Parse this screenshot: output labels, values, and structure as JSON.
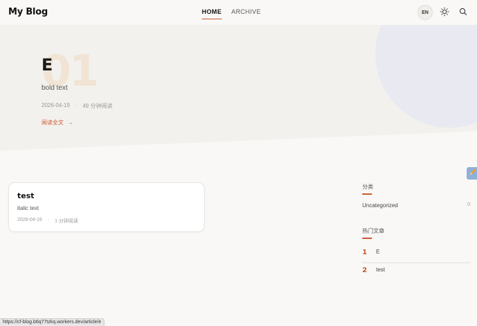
{
  "header": {
    "logo": "My Blog",
    "nav": [
      {
        "label": "HOME",
        "active": true
      },
      {
        "label": "ARCHIVE",
        "active": false
      }
    ],
    "lang": "EN",
    "icons": {
      "theme": "sun-icon",
      "search": "search-icon"
    }
  },
  "hero": {
    "number": "01",
    "title": "E",
    "subtitle": "bold text",
    "date": "2026-04-19",
    "separator": "·",
    "read_time": "49 分钟阅读",
    "read_more": "阅读全文",
    "arrow": "→"
  },
  "articles": [
    {
      "title": "test",
      "excerpt": "italic text",
      "date": "2026-04-19",
      "separator": "·",
      "read_time": "1 分钟阅读"
    }
  ],
  "sidebar": {
    "categories_heading": "分类",
    "categories": [
      {
        "name": "Uncategorized",
        "count": "0"
      }
    ],
    "popular_heading": "热门文章",
    "popular": [
      {
        "rank": "1",
        "title": "E"
      },
      {
        "rank": "2",
        "title": "test"
      }
    ]
  },
  "status_bar": {
    "url": "https://cf-blog.b6q77tzkq.workers.dev/article/e"
  },
  "colors": {
    "accent": "#c8582b",
    "hero_bg": "#f3f1ed",
    "circle": "#e9e9f2",
    "page_bg": "#f9f8f6"
  }
}
